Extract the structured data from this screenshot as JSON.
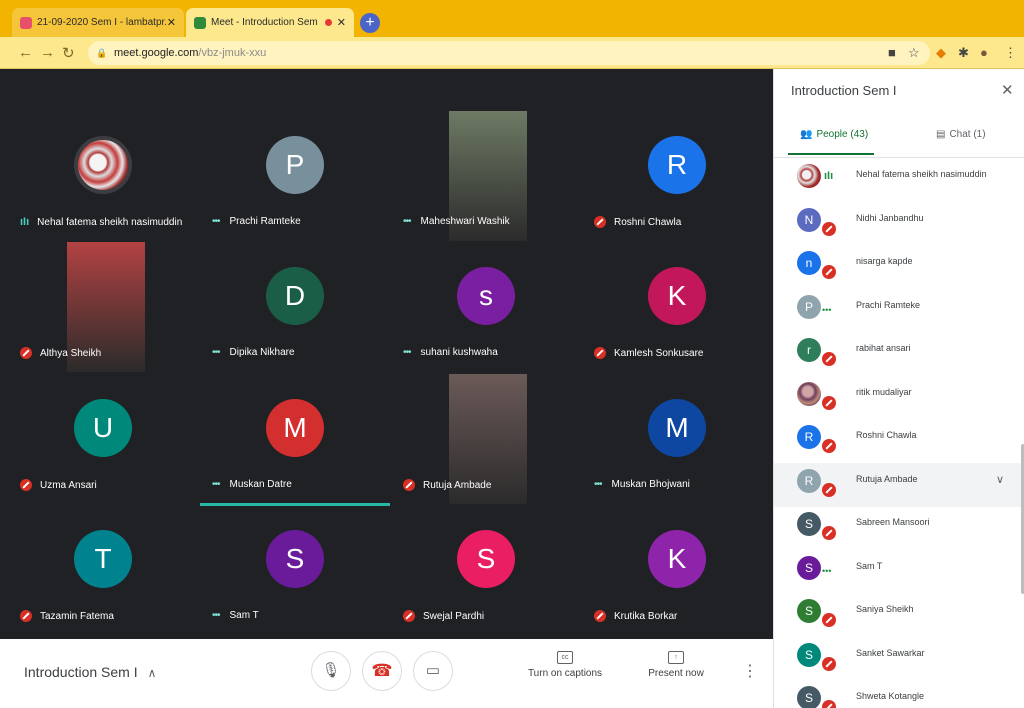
{
  "browser": {
    "tabs": [
      {
        "title": "21-09-2020 Sem I - lambatpr...",
        "close": "✕",
        "favicon_color": "#e84f6b"
      },
      {
        "title": "Meet - Introduction Sem I",
        "close": "✕",
        "favicon_color": "#2f8a3b"
      }
    ],
    "new_tab": "+",
    "url_host": "meet.google.com",
    "url_path": "/vbz-jmuk-xxu"
  },
  "tiles": [
    {
      "name": "Nehal fatema sheikh nasimuddin",
      "mic": "speak",
      "kind": "photo"
    },
    {
      "name": "Prachi Ramteke",
      "mic": "dots",
      "kind": "avatar",
      "initial": "P",
      "color": "#78909c"
    },
    {
      "name": "Maheshwari Washik",
      "mic": "dots",
      "kind": "video",
      "video_color": "#6e7a64"
    },
    {
      "name": "Roshni Chawla",
      "mic": "muted",
      "kind": "avatar",
      "initial": "R",
      "color": "#1a73e8"
    },
    {
      "name": "Althya Sheikh",
      "mic": "muted",
      "kind": "video",
      "video_color": "#b34242"
    },
    {
      "name": "Dipika Nikhare",
      "mic": "dots",
      "kind": "avatar",
      "initial": "D",
      "color": "#1b5e48"
    },
    {
      "name": "suhani kushwaha",
      "mic": "dots",
      "kind": "avatar",
      "initial": "s",
      "color": "#7b1fa2"
    },
    {
      "name": "Kamlesh Sonkusare",
      "mic": "muted",
      "kind": "avatar",
      "initial": "K",
      "color": "#c2185b"
    },
    {
      "name": "Uzma Ansari",
      "mic": "muted",
      "kind": "avatar",
      "initial": "U",
      "color": "#00897b"
    },
    {
      "name": "Muskan Datre",
      "mic": "dots",
      "kind": "avatar",
      "initial": "M",
      "color": "#d32f2f"
    },
    {
      "name": "Rutuja Ambade",
      "mic": "muted",
      "kind": "video",
      "video_color": "#6b5a58"
    },
    {
      "name": "Muskan Bhojwani",
      "mic": "dots",
      "kind": "avatar",
      "initial": "M",
      "color": "#0d47a1"
    },
    {
      "name": "Tazamin Fatema",
      "mic": "muted",
      "kind": "avatar",
      "initial": "T",
      "color": "#00838f"
    },
    {
      "name": "Sam T",
      "mic": "dots",
      "kind": "avatar",
      "initial": "S",
      "color": "#6a1b9a"
    },
    {
      "name": "Swejal Pardhi",
      "mic": "muted",
      "kind": "avatar",
      "initial": "S",
      "color": "#e91e63"
    },
    {
      "name": "Krutika Borkar",
      "mic": "muted",
      "kind": "avatar",
      "initial": "K",
      "color": "#8e24aa"
    }
  ],
  "bottom": {
    "meeting_title": "Introduction Sem I",
    "captions_label": "Turn on captions",
    "present_label": "Present now"
  },
  "panel": {
    "title": "Introduction Sem I",
    "people_tab": "People (43)",
    "chat_tab": "Chat (1)",
    "people": [
      {
        "name": "Nehal fatema sheikh nasimuddin",
        "status": "speak",
        "kind": "photo"
      },
      {
        "name": "Nidhi Janbandhu",
        "status": "muted",
        "initial": "N",
        "color": "#5c6bc0"
      },
      {
        "name": "nisarga kapde",
        "status": "muted",
        "initial": "n",
        "color": "#1a73e8"
      },
      {
        "name": "Prachi Ramteke",
        "status": "dots",
        "initial": "P",
        "color": "#90a4ae"
      },
      {
        "name": "rabihat ansari",
        "status": "muted",
        "initial": "r",
        "color": "#2e7d5b"
      },
      {
        "name": "ritik mudaliyar",
        "status": "muted",
        "kind": "photo2"
      },
      {
        "name": "Roshni Chawla",
        "status": "muted",
        "initial": "R",
        "color": "#1a73e8"
      },
      {
        "name": "Rutuja Ambade",
        "status": "muted",
        "initial": "R",
        "color": "#90a4ae",
        "highlight": true
      },
      {
        "name": "Sabreen Mansoori",
        "status": "muted",
        "initial": "S",
        "color": "#455a64"
      },
      {
        "name": "Sam T",
        "status": "dots",
        "initial": "S",
        "color": "#6a1b9a"
      },
      {
        "name": "Saniya Sheikh",
        "status": "muted",
        "initial": "S",
        "color": "#2e7d32"
      },
      {
        "name": "Sanket Sawarkar",
        "status": "muted",
        "initial": "S",
        "color": "#00897b"
      },
      {
        "name": "Shweta Kotangle",
        "status": "muted",
        "initial": "S",
        "color": "#455a64"
      }
    ]
  }
}
